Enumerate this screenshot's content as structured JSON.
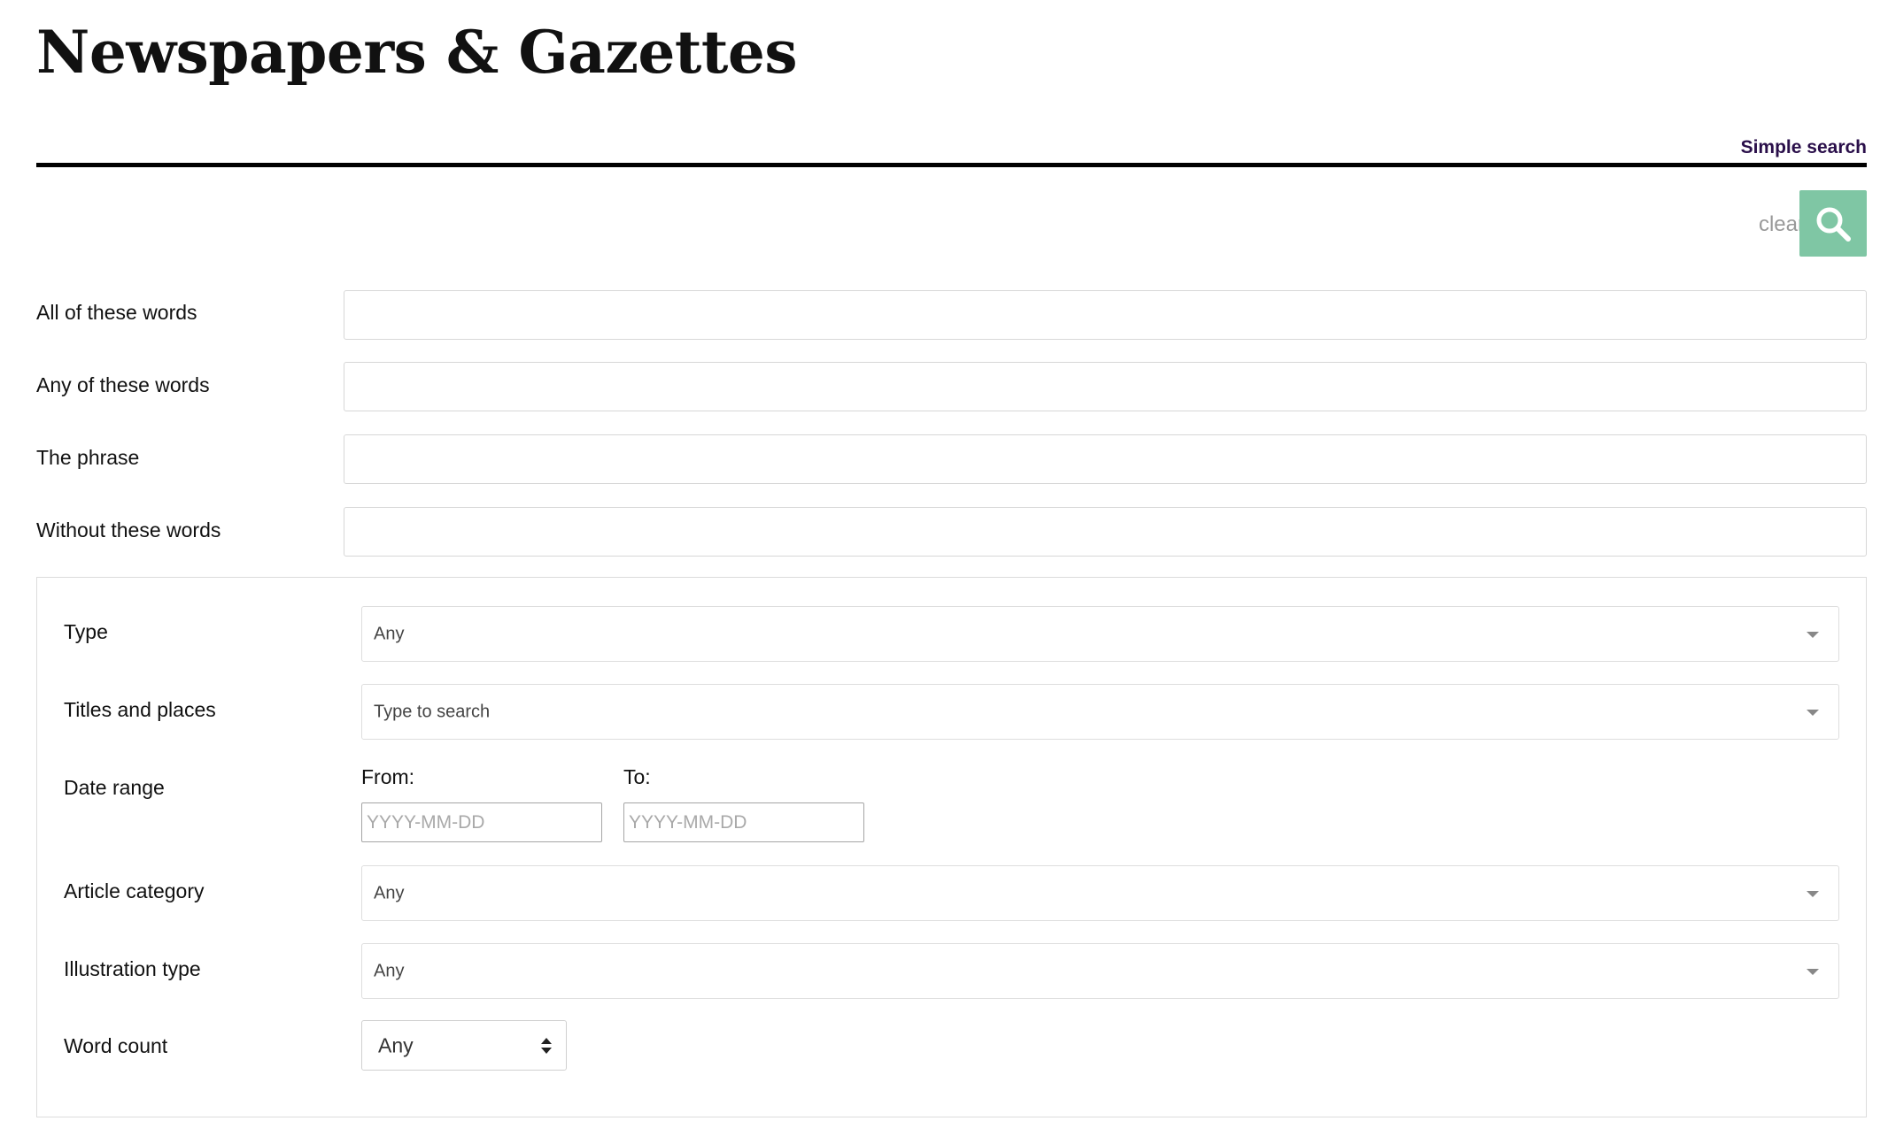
{
  "page": {
    "title": "Newspapers & Gazettes"
  },
  "toolbar": {
    "simple_search_label": "Simple search",
    "clear_label": "clear",
    "search_icon": "search-icon",
    "search_button_color": "#7fc6a4"
  },
  "keyword_fields": [
    {
      "label": "All of these words",
      "value": ""
    },
    {
      "label": "Any of these words",
      "value": ""
    },
    {
      "label": "The phrase",
      "value": ""
    },
    {
      "label": "Without these words",
      "value": ""
    }
  ],
  "filters": {
    "type": {
      "label": "Type",
      "selected": "Any"
    },
    "titles_places": {
      "label": "Titles and places",
      "placeholder": "Type to search"
    },
    "date_range": {
      "label": "Date range",
      "from_label": "From:",
      "to_label": "To:",
      "from_placeholder": "YYYY-MM-DD",
      "to_placeholder": "YYYY-MM-DD"
    },
    "article_category": {
      "label": "Article category",
      "selected": "Any"
    },
    "illustration_type": {
      "label": "Illustration type",
      "selected": "Any"
    },
    "word_count": {
      "label": "Word count",
      "selected": "Any"
    }
  }
}
